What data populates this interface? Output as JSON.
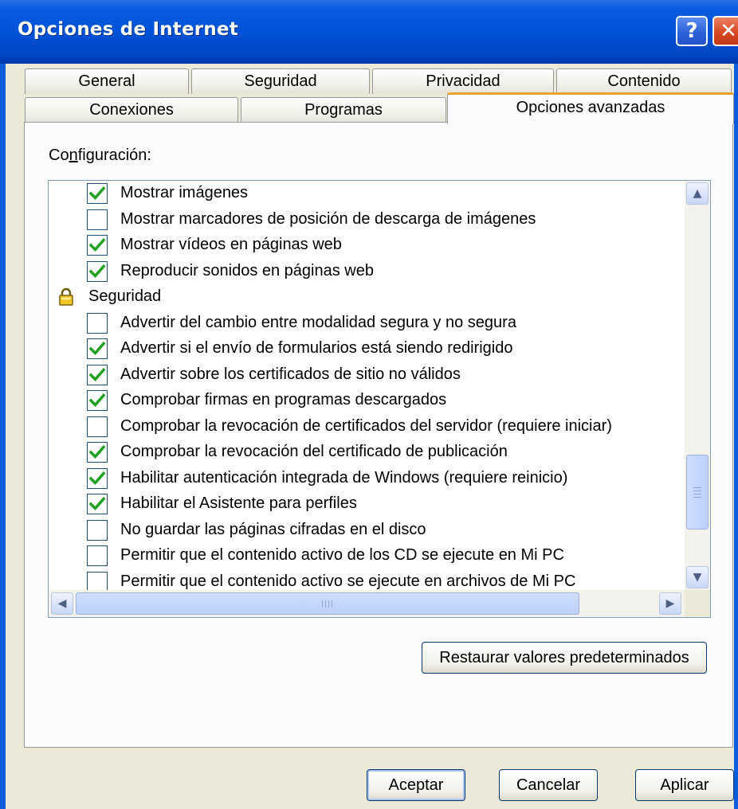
{
  "window": {
    "title": "Opciones de Internet"
  },
  "tabs": [
    {
      "label": "General"
    },
    {
      "label": "Seguridad"
    },
    {
      "label": "Privacidad"
    },
    {
      "label": "Contenido"
    },
    {
      "label": "Conexiones"
    },
    {
      "label": "Programas"
    },
    {
      "label": "Opciones avanzadas",
      "active": true
    }
  ],
  "settings": {
    "label": "Configuración:",
    "items": [
      {
        "text": "Mostrar imágenes",
        "checked": true
      },
      {
        "text": "Mostrar marcadores de posición de descarga de imágenes",
        "checked": false
      },
      {
        "text": "Mostrar vídeos en páginas web",
        "checked": true
      },
      {
        "text": "Reproducir sonidos en páginas web",
        "checked": true
      },
      {
        "text": "Seguridad",
        "category": true
      },
      {
        "text": "Advertir del cambio entre modalidad segura y no segura",
        "checked": false
      },
      {
        "text": "Advertir si el envío de formularios está siendo redirigido",
        "checked": true
      },
      {
        "text": "Advertir sobre los certificados de sitio no válidos",
        "checked": true
      },
      {
        "text": "Comprobar firmas en programas descargados",
        "checked": true
      },
      {
        "text": "Comprobar la revocación de certificados del servidor (requiere iniciar)",
        "checked": false
      },
      {
        "text": "Comprobar la revocación del certificado de publicación",
        "checked": true
      },
      {
        "text": "Habilitar autenticación integrada de Windows (requiere reinicio)",
        "checked": true
      },
      {
        "text": "Habilitar el Asistente para perfiles",
        "checked": true
      },
      {
        "text": "No guardar las páginas cifradas en el disco",
        "checked": false
      },
      {
        "text": "Permitir que el contenido activo de los CD se ejecute en Mi PC",
        "checked": false
      },
      {
        "text": "Permitir que el contenido activo se ejecute en archivos de Mi PC",
        "checked": false
      }
    ]
  },
  "buttons": {
    "restore": "Restaurar valores predeterminados",
    "ok": "Aceptar",
    "cancel": "Cancelar",
    "apply": "Aplicar"
  },
  "colors": {
    "titlebar": "#0053d8",
    "tab_active_accent": "#f1a52c",
    "check": "#21a121",
    "dialog_bg": "#ece9d8"
  }
}
